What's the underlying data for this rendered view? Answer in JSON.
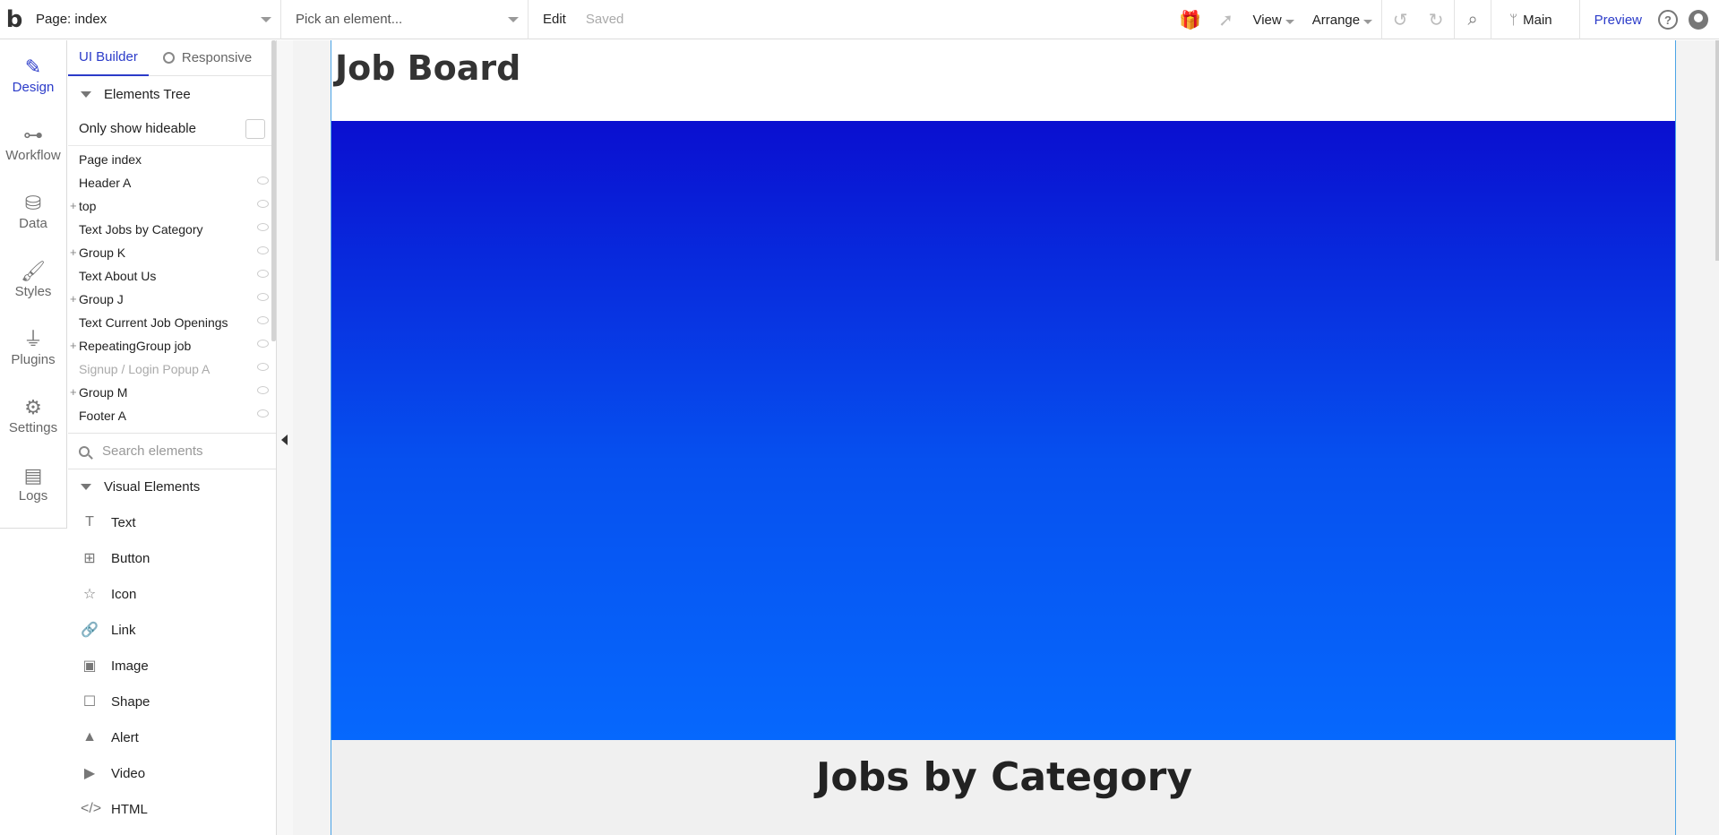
{
  "topbar": {
    "page_label": "Page: index",
    "element_picker": "Pick an element...",
    "edit_label": "Edit",
    "status": "Saved",
    "view_label": "View",
    "arrange_label": "Arrange",
    "branch_label": "Main",
    "preview_label": "Preview",
    "help_glyph": "?"
  },
  "leftnav": {
    "items": [
      {
        "label": "Design",
        "icon": "design-icon",
        "active": true
      },
      {
        "label": "Workflow",
        "icon": "workflow-icon"
      },
      {
        "label": "Data",
        "icon": "database-icon"
      },
      {
        "label": "Styles",
        "icon": "brush-icon"
      },
      {
        "label": "Plugins",
        "icon": "plug-icon"
      },
      {
        "label": "Settings",
        "icon": "gear-icon"
      },
      {
        "label": "Logs",
        "icon": "document-icon"
      }
    ]
  },
  "panel": {
    "tabs": [
      "UI Builder",
      "Responsive"
    ],
    "elements_tree_title": "Elements Tree",
    "only_hideable_label": "Only show hideable",
    "tree": [
      {
        "label": "Page index"
      },
      {
        "label": "Header A"
      },
      {
        "label": "top",
        "expandable": true
      },
      {
        "label": "Text Jobs by Category"
      },
      {
        "label": "Group K",
        "expandable": true
      },
      {
        "label": "Text About Us"
      },
      {
        "label": "Group J",
        "expandable": true
      },
      {
        "label": "Text Current Job Openings"
      },
      {
        "label": "RepeatingGroup job",
        "expandable": true
      },
      {
        "label": "Signup / Login Popup A",
        "dim": true
      },
      {
        "label": "Group M",
        "expandable": true
      },
      {
        "label": "Footer A"
      }
    ],
    "search_placeholder": "Search elements",
    "visual_elements_title": "Visual Elements",
    "visual_elements": [
      {
        "label": "Text",
        "icon": "T"
      },
      {
        "label": "Button",
        "icon": "⊞"
      },
      {
        "label": "Icon",
        "icon": "☆"
      },
      {
        "label": "Link",
        "icon": "🔗"
      },
      {
        "label": "Image",
        "icon": "▣"
      },
      {
        "label": "Shape",
        "icon": "☐"
      },
      {
        "label": "Alert",
        "icon": "▲"
      },
      {
        "label": "Video",
        "icon": "▶"
      },
      {
        "label": "HTML",
        "icon": "</>"
      }
    ]
  },
  "canvas": {
    "page_title": "Job Board",
    "section_title": "Jobs by Category",
    "hero_colors": [
      "#0a0fd0",
      "#0668fd"
    ]
  }
}
